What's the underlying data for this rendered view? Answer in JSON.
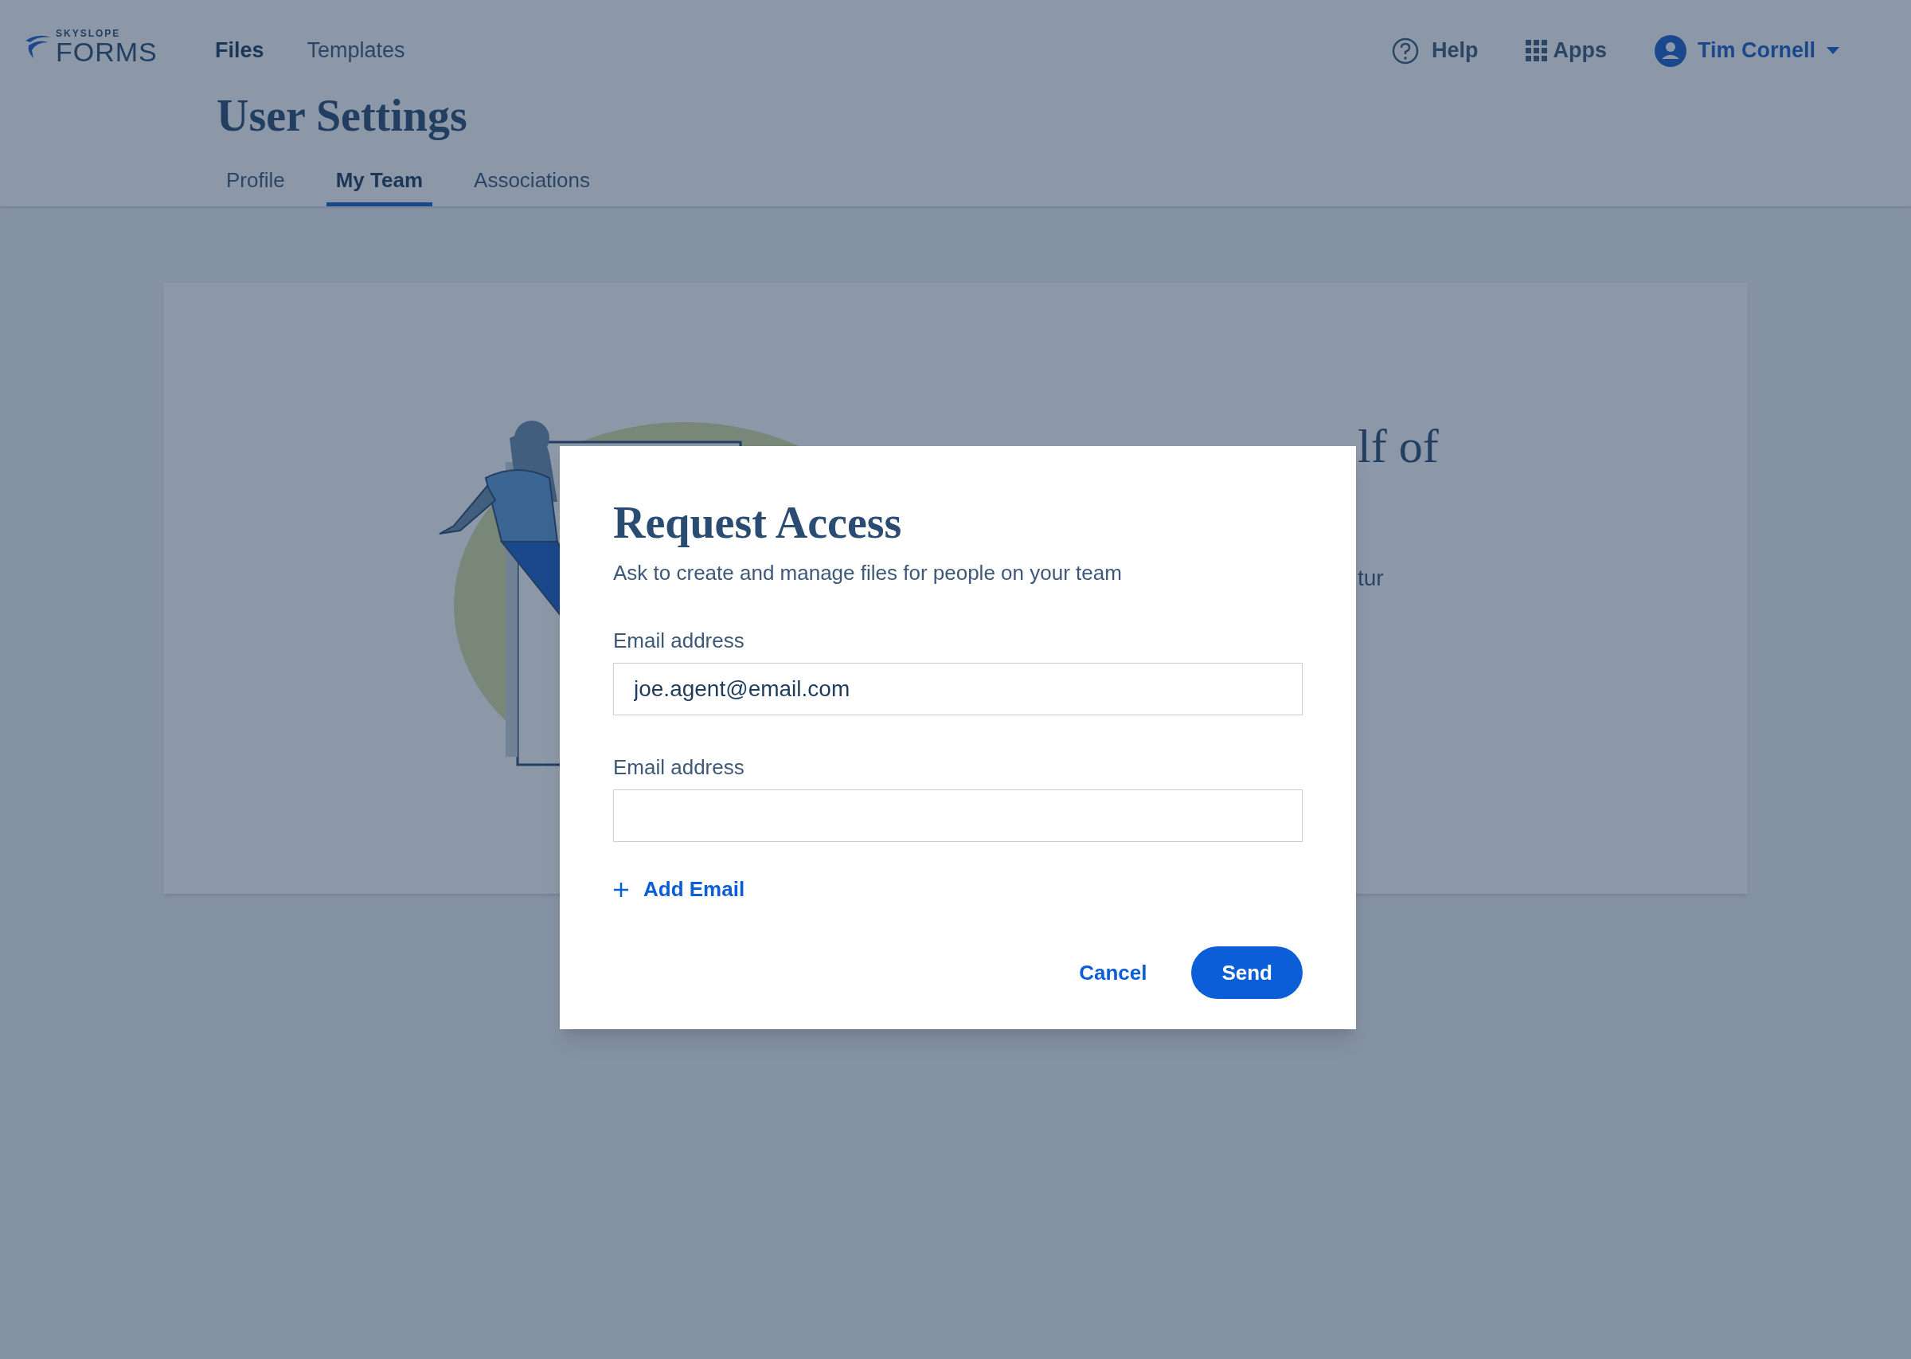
{
  "header": {
    "logo": {
      "brand_small": "SKYSLOPE",
      "brand": "FORMS"
    },
    "nav": [
      {
        "label": "Files",
        "selected": true
      },
      {
        "label": "Templates",
        "selected": false
      }
    ],
    "help": "Help",
    "apps": "Apps",
    "user": "Tim Cornell"
  },
  "page": {
    "title": "User Settings",
    "tabs": [
      {
        "label": "Profile",
        "selected": false
      },
      {
        "label": "My Team",
        "selected": true
      },
      {
        "label": "Associations",
        "selected": false
      }
    ]
  },
  "card": {
    "heading": "lf of",
    "text_fragment": "tur"
  },
  "dialog": {
    "title": "Request Access",
    "subtitle": "Ask to create and manage files for people on your team",
    "fields": [
      {
        "label": "Email address",
        "value": "joe.agent@email.com"
      },
      {
        "label": "Email address"
      }
    ],
    "add_link": "Add Email",
    "buttons": [
      {
        "label": "Cancel",
        "kind": "link"
      },
      {
        "label": "Send",
        "kind": "primary"
      }
    ]
  }
}
